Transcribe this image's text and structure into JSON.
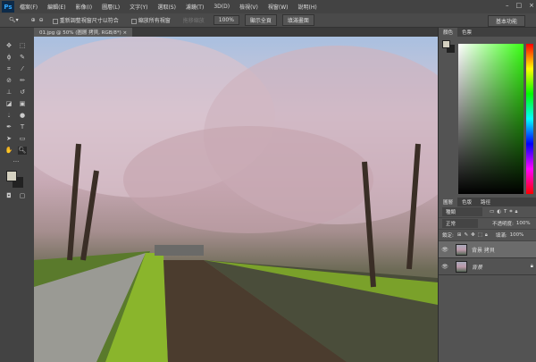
{
  "app": {
    "logo": "Ps"
  },
  "menu": [
    "檔案(F)",
    "編輯(E)",
    "影像(I)",
    "圖層(L)",
    "文字(Y)",
    "選取(S)",
    "濾鏡(T)",
    "3D(D)",
    "檢視(V)",
    "視窗(W)",
    "說明(H)"
  ],
  "window_controls": [
    "–",
    "□",
    "×"
  ],
  "options": {
    "resize_windows": "重新調整視窗尺寸以符合",
    "zoom_all": "縮放所有視窗",
    "scrubby": "拖移縮放",
    "zoom": "100%",
    "fit_screen": "顯示全頁",
    "fill_screen": "填滿畫面",
    "workspace": "基本功能"
  },
  "document": {
    "tab": "01.jpg @ 50% (圖層 拷貝, RGB/8*) ×"
  },
  "color_panel": {
    "tabs": [
      "顏色",
      "色票"
    ],
    "foreground": "#d4d0c0",
    "background": "#222222"
  },
  "layers_panel": {
    "tabs": [
      "圖層",
      "色版",
      "路徑"
    ],
    "filter": "種類",
    "blend_mode": "正常",
    "opacity_label": "不透明度:",
    "opacity": "100%",
    "lock_label": "鎖定:",
    "fill_label": "填滿:",
    "fill": "100%",
    "layers": [
      {
        "name": "背景 拷貝",
        "selected": true
      },
      {
        "name": "背景",
        "locked": true
      }
    ]
  }
}
